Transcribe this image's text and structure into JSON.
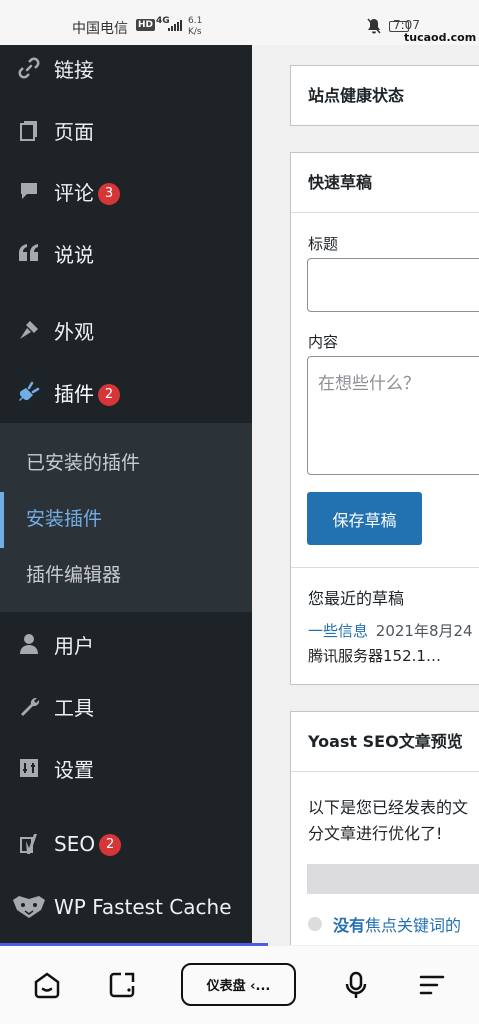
{
  "status_bar": {
    "carrier": "中国电信",
    "hd": "HD",
    "signal_type": "4G",
    "speed_value": "6.1",
    "speed_unit": "K/s",
    "time": "7:07",
    "watermark": "tucaod.com"
  },
  "sidebar": {
    "items": [
      {
        "label": "链接",
        "icon": "link-icon"
      },
      {
        "label": "页面",
        "icon": "pages-icon"
      },
      {
        "label": "评论",
        "icon": "comments-icon",
        "badge": "3"
      },
      {
        "label": "说说",
        "icon": "quote-icon"
      },
      {
        "label": "外观",
        "icon": "appearance-icon"
      },
      {
        "label": "插件",
        "icon": "plugins-icon",
        "badge": "2"
      },
      {
        "label": "用户",
        "icon": "users-icon"
      },
      {
        "label": "工具",
        "icon": "tools-icon"
      },
      {
        "label": "设置",
        "icon": "settings-icon"
      },
      {
        "label": "SEO",
        "icon": "yoast-icon",
        "badge": "2"
      },
      {
        "label": "WP Fastest Cache",
        "icon": "cheetah-icon"
      }
    ],
    "submenu": [
      {
        "label": "已安装的插件"
      },
      {
        "label": "安装插件",
        "active": true
      },
      {
        "label": "插件编辑器"
      }
    ]
  },
  "main": {
    "site_health": {
      "title": "站点健康状态"
    },
    "quick_draft": {
      "title": "快速草稿",
      "title_label": "标题",
      "title_value": "",
      "content_label": "内容",
      "content_placeholder": "在想些什么？",
      "save_button": "保存草稿",
      "recent_heading": "您最近的草稿",
      "recent_link": "一些信息",
      "recent_date": "2021年8月24",
      "recent_excerpt": "腾讯服务器152.1…"
    },
    "yoast": {
      "title": "Yoast SEO文章预览",
      "text_line1": "以下是您已经发表的文",
      "text_line2": "分文章进行优化了!",
      "item_prefix": "没有",
      "item_text": "焦点关键词的"
    }
  },
  "bottom_bar": {
    "tab_label": "仪表盘 ‹..."
  },
  "colors": {
    "sidebar_bg": "#1d2327",
    "submenu_bg": "#2c3338",
    "accent": "#2271b1",
    "active_link": "#72aee6",
    "badge": "#d63638"
  }
}
